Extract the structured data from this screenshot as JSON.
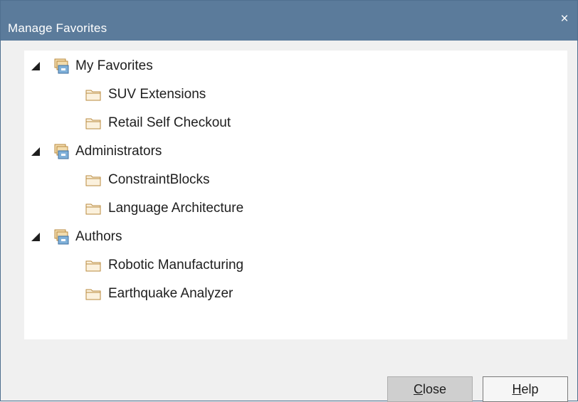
{
  "dialog": {
    "title": "Manage Favorites",
    "close_glyph": "×"
  },
  "tree": {
    "groups": [
      {
        "label": "My Favorites",
        "expanded": true,
        "items": [
          {
            "label": "SUV Extensions"
          },
          {
            "label": "Retail Self Checkout"
          }
        ]
      },
      {
        "label": "Administrators",
        "expanded": true,
        "items": [
          {
            "label": "ConstraintBlocks"
          },
          {
            "label": "Language Architecture"
          }
        ]
      },
      {
        "label": "Authors",
        "expanded": true,
        "items": [
          {
            "label": "Robotic Manufacturing"
          },
          {
            "label": "Earthquake Analyzer"
          }
        ]
      }
    ]
  },
  "buttons": {
    "close": {
      "mnemonic": "C",
      "rest": "lose"
    },
    "help": {
      "mnemonic": "H",
      "rest": "elp"
    }
  },
  "icons": {
    "expander": "expanded-triangle-icon",
    "group": "favorites-group-icon",
    "item": "folder-icon"
  },
  "colors": {
    "titlebar": "#5b7b9b",
    "folder": "#e8c68a",
    "folder_stroke": "#b98a3e",
    "group_box": "#7fb0d9"
  }
}
